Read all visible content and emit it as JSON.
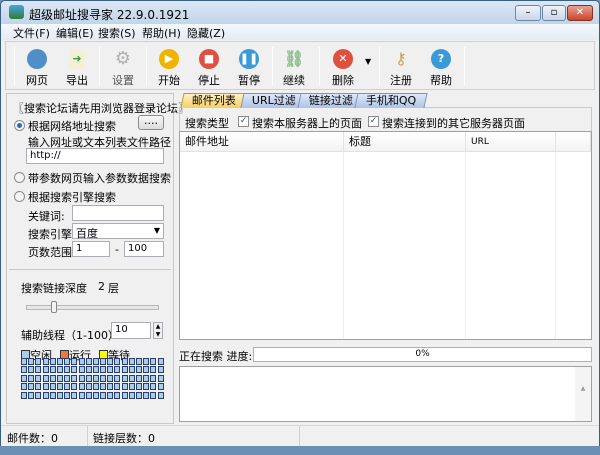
{
  "window": {
    "title": "超级邮址搜寻家 22.9.0.1921",
    "controls": [
      "minimize",
      "maximize",
      "close"
    ]
  },
  "menu": [
    {
      "label": "文件(F)"
    },
    {
      "label": "编辑(E)"
    },
    {
      "label": "搜索(S)"
    },
    {
      "label": "帮助(H)"
    },
    {
      "label": "隐藏(Z)"
    }
  ],
  "toolbar": [
    {
      "label": "网页",
      "icon": "globe-icon",
      "color": "#4e8fc9"
    },
    {
      "label": "导出",
      "icon": "export-icon",
      "color": "#3c9b3c"
    },
    {
      "label": "设置",
      "icon": "gear-icon",
      "color": "#bdbdbd"
    },
    {
      "label": "开始",
      "icon": "play-icon",
      "color": "#f0b400"
    },
    {
      "label": "停止",
      "icon": "stop-icon",
      "color": "#e05040"
    },
    {
      "label": "暂停",
      "icon": "pause-icon",
      "color": "#3a9ad8"
    },
    {
      "label": "继续",
      "icon": "link-icon",
      "color": "#8fbf8f"
    },
    {
      "label": "删除",
      "icon": "delete-icon",
      "color": "#e05040"
    },
    {
      "label": "注册",
      "icon": "key-icon",
      "color": "#c9a24a"
    },
    {
      "label": "帮助",
      "icon": "help-icon",
      "color": "#3a9ad8"
    }
  ],
  "left": {
    "notice": "〖搜索论坛请先用浏览器登录论坛〗",
    "mode_url": "根据网络地址搜索",
    "browse_label": "....",
    "url_hint": "输入网址或文本列表文件路径",
    "url_value": "http://",
    "mode_param": "带参数网页输入参数数据搜索",
    "mode_engine": "根据搜索引擎搜索",
    "keyword_label": "关键词:",
    "keyword_value": "",
    "engine_label": "搜索引擎",
    "engine_value": "百度",
    "pages_label": "页数范围",
    "page_from": "1",
    "page_dash": "-",
    "page_to": "100",
    "depth_label": "搜索链接深度",
    "depth_value": "2",
    "depth_unit": "层",
    "threads_label": "辅助线程（1-100）",
    "threads_value": "10",
    "legend": [
      {
        "label": "空闲",
        "color": "#a9cdea"
      },
      {
        "label": "运行",
        "color": "#f07838"
      },
      {
        "label": "等待",
        "color": "#ffff00"
      }
    ],
    "thread_count": 100
  },
  "tabs": [
    {
      "label": "邮件列表",
      "active": true
    },
    {
      "label": "URL过滤"
    },
    {
      "label": "链接过滤"
    },
    {
      "label": "手机和QQ"
    }
  ],
  "search_type": {
    "label": "搜索类型",
    "opt1": "搜索本服务器上的页面",
    "opt1_checked": true,
    "opt2": "搜索连接到的其它服务器页面",
    "opt2_checked": true
  },
  "table": {
    "columns": [
      "邮件地址",
      "标题",
      "URL"
    ],
    "rows": []
  },
  "progress": {
    "label": "正在搜索 进度:",
    "percent_text": "0%",
    "percent": 0
  },
  "status": {
    "emails": "邮件数：0",
    "depth": "链接层数：0"
  }
}
